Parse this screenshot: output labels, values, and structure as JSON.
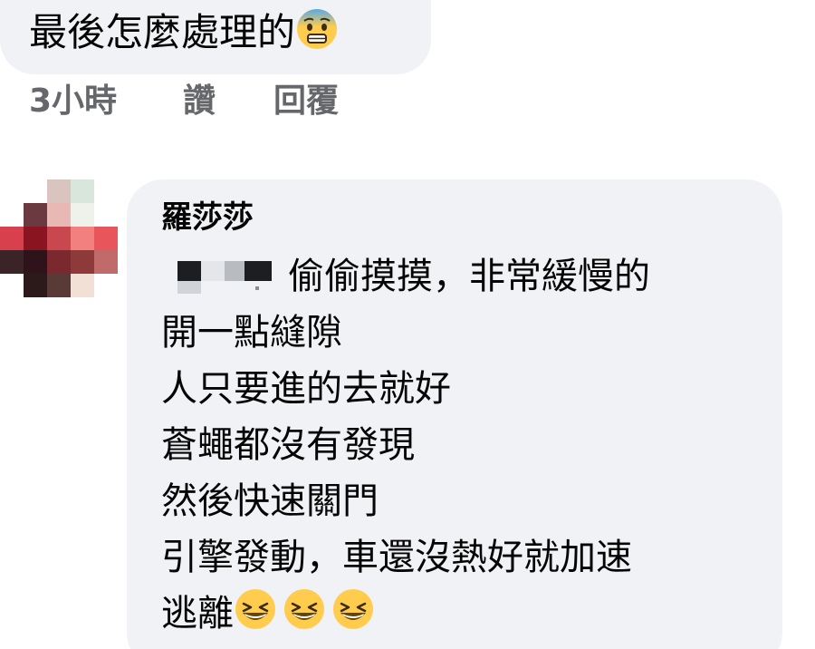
{
  "reply": {
    "text": "最後怎麼處理的",
    "emoji": "anxious-face-emoji"
  },
  "actions": {
    "time": "3小時",
    "like": "讚",
    "reply": "回覆"
  },
  "comment": {
    "author": "羅莎莎",
    "lines": [
      "偷偷摸摸，非常緩慢的",
      "開一點縫隙",
      "人只要進的去就好",
      "蒼蠅都沒有發現",
      "然後快速關門",
      "引擎發動，車還沒熱好就加速",
      "逃離"
    ],
    "trailing_emoji": [
      "grinning-squinting-face-emoji",
      "grinning-squinting-face-emoji",
      "grinning-squinting-face-emoji"
    ]
  },
  "colors": {
    "bubble": "#f0f2f5",
    "text": "#050505",
    "secondary": "#65676b",
    "emoji_yellow": "#ffcc4d"
  }
}
